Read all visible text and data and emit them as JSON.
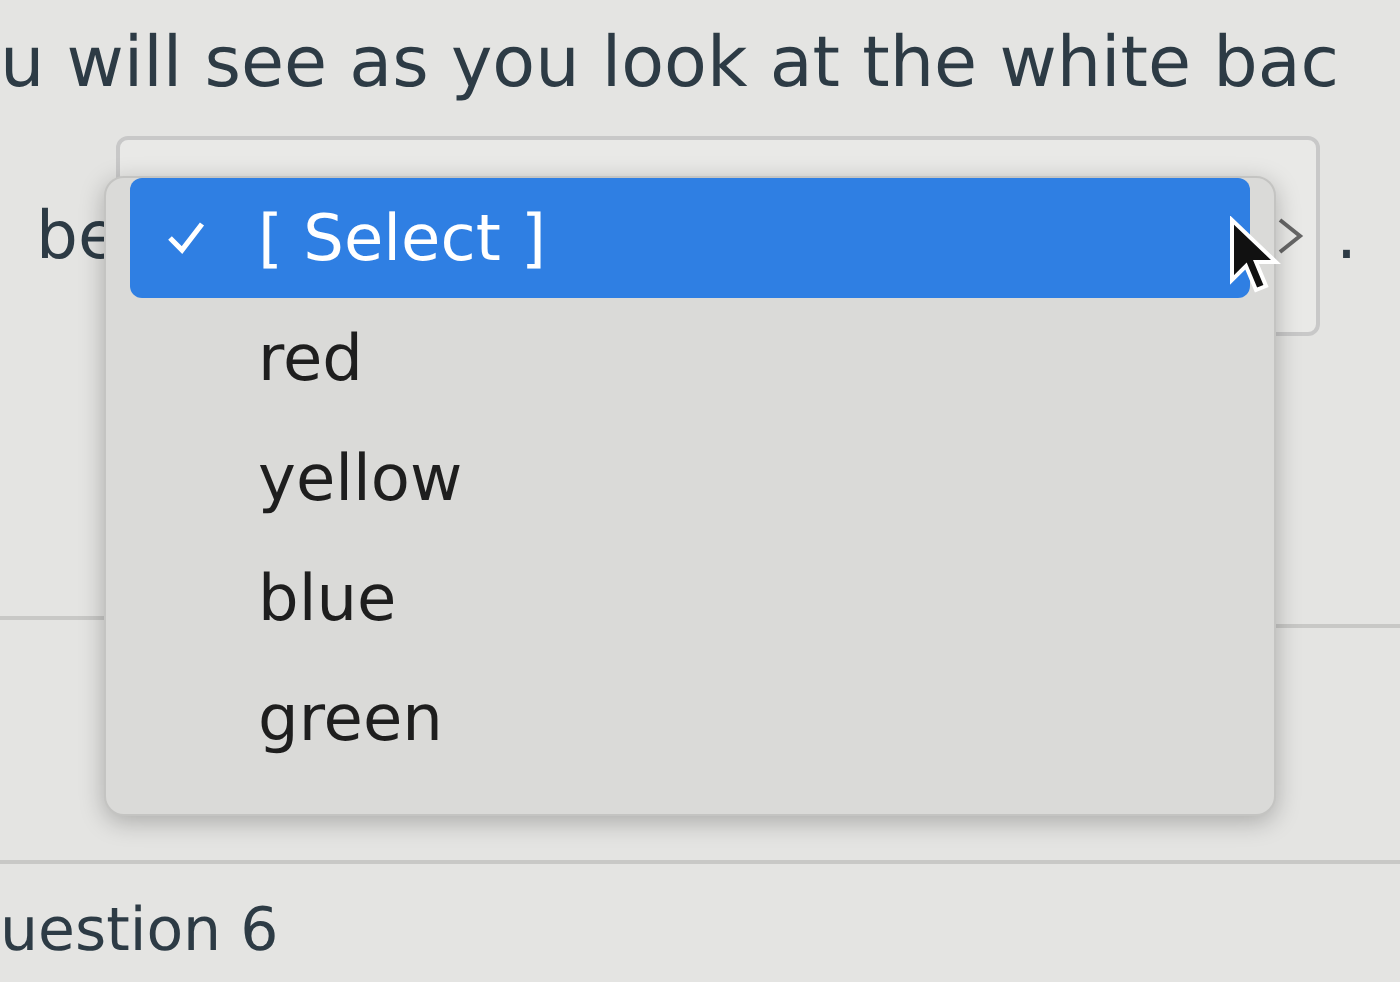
{
  "top_text": "u will see as you look at the white bac",
  "line2": {
    "before": "be",
    "after": "."
  },
  "dropdown": {
    "options": [
      {
        "label": "[ Select ]",
        "selected": true
      },
      {
        "label": "red",
        "selected": false
      },
      {
        "label": "yellow",
        "selected": false
      },
      {
        "label": "blue",
        "selected": false
      },
      {
        "label": "green",
        "selected": false
      }
    ]
  },
  "next_heading": "uestion 6"
}
